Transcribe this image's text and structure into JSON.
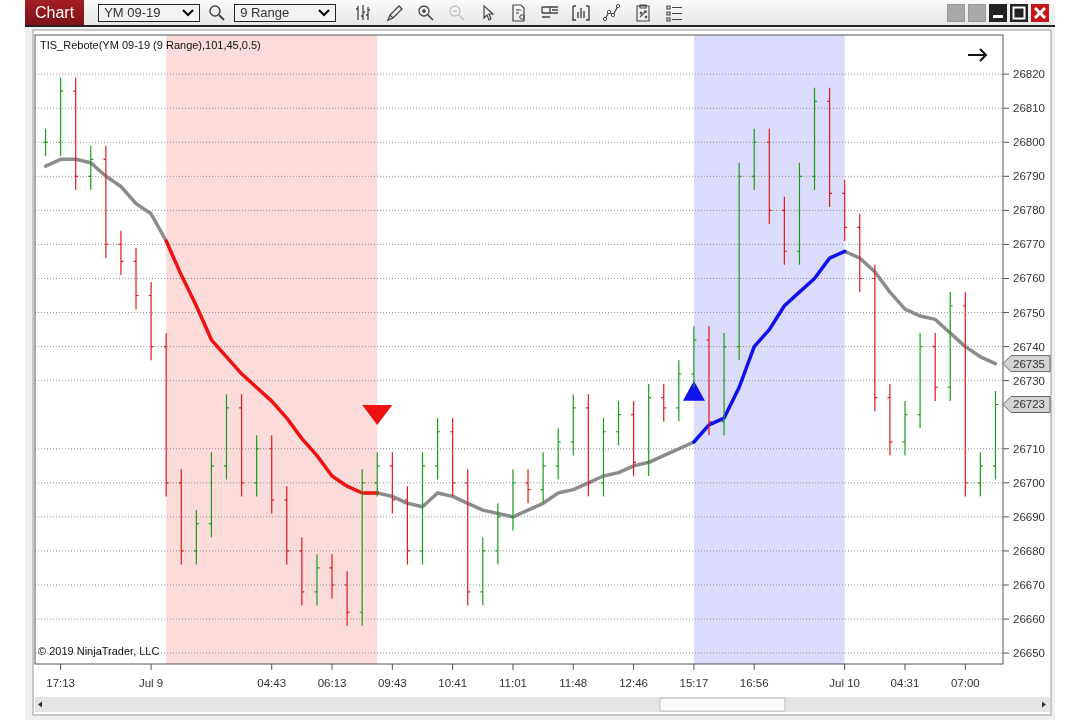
{
  "toolbar": {
    "title_button": "Chart",
    "instrument": {
      "value": "YM 09-19"
    },
    "period": {
      "value": "9 Range"
    },
    "tools": [
      {
        "disabled": false
      },
      {
        "disabled": false
      },
      {
        "disabled": false
      },
      {
        "disabled": true
      },
      {
        "disabled": false
      },
      {
        "disabled": false
      },
      {
        "disabled": false
      },
      {
        "disabled": false
      },
      {
        "disabled": false
      },
      {
        "disabled": false
      },
      {
        "disabled": false
      }
    ]
  },
  "chart": {
    "indicator_label": "TIS_Rebote(YM 09-19 (9 Range),101,45,0.5)",
    "copyright": "© 2019 NinjaTrader, LLC",
    "chart_data": {
      "type": "line",
      "categories": [
        null,
        "17:13",
        null,
        null,
        null,
        null,
        null,
        "Jul 9",
        null,
        null,
        null,
        null,
        null,
        null,
        null,
        "04:43",
        null,
        null,
        null,
        "06:13",
        null,
        null,
        null,
        "09:43",
        null,
        null,
        null,
        "10:41",
        null,
        null,
        null,
        "11:01",
        null,
        null,
        null,
        "11:48",
        null,
        null,
        null,
        "12:46",
        null,
        null,
        null,
        "15:17",
        null,
        null,
        null,
        "16:56",
        null,
        null,
        null,
        null,
        null,
        "Jul 10",
        null,
        null,
        null,
        "04:31",
        null,
        null,
        null,
        "07:00",
        null,
        null
      ],
      "series": [
        {
          "color": "#8c8c8c",
          "values": [
            26793,
            26795,
            26795,
            26794,
            26790,
            26787,
            26782,
            26779,
            26771,
            null,
            null,
            null,
            null,
            null,
            null,
            null,
            null,
            null,
            null,
            null,
            null,
            null,
            26697,
            26696,
            26694,
            26693,
            26697,
            26696,
            26694,
            26692,
            26691,
            26690,
            26692,
            26694,
            26697,
            26698,
            26700,
            26702,
            26703,
            26705,
            26706,
            26708,
            26710,
            26712,
            null,
            null,
            null,
            null,
            null,
            null,
            null,
            null,
            null,
            26768,
            26766,
            26762,
            26756,
            26751,
            26749,
            26748,
            26744,
            26740,
            26737,
            26735
          ]
        },
        {
          "color": "#ee1111",
          "values": [
            null,
            null,
            null,
            null,
            null,
            null,
            null,
            null,
            26771,
            26761,
            26752,
            26742,
            26737,
            26732,
            26728,
            26724,
            26719,
            26713,
            26708,
            26702,
            26699,
            26697,
            26697,
            null,
            null,
            null,
            null,
            null,
            null,
            null,
            null,
            null,
            null,
            null,
            null,
            null,
            null,
            null,
            null,
            null,
            null,
            null,
            null,
            null,
            null,
            null,
            null,
            null,
            null,
            null,
            null,
            null,
            null,
            null,
            null,
            null,
            null,
            null,
            null,
            null,
            null,
            null,
            null,
            null
          ]
        },
        {
          "color": "#1111ee",
          "values": [
            null,
            null,
            null,
            null,
            null,
            null,
            null,
            null,
            null,
            null,
            null,
            null,
            null,
            null,
            null,
            null,
            null,
            null,
            null,
            null,
            null,
            null,
            null,
            null,
            null,
            null,
            null,
            null,
            null,
            null,
            null,
            null,
            null,
            null,
            null,
            null,
            null,
            null,
            null,
            null,
            null,
            null,
            null,
            26712,
            26717,
            26719,
            26728,
            26740,
            26745,
            26752,
            26756,
            26760,
            26766,
            26768,
            null,
            null,
            null,
            null,
            null,
            null,
            null,
            null,
            null,
            null
          ]
        }
      ],
      "ylim": [
        26646.8,
        26831.5
      ],
      "yticks": [
        26650,
        26660,
        26670,
        26680,
        26690,
        26700,
        26710,
        26730,
        26740,
        26750,
        26760,
        26770,
        26780,
        26790,
        26800,
        26810,
        26820
      ],
      "grid": true
    },
    "price_tags": [
      {
        "label": "26735"
      },
      {
        "label": "26723"
      }
    ]
  }
}
